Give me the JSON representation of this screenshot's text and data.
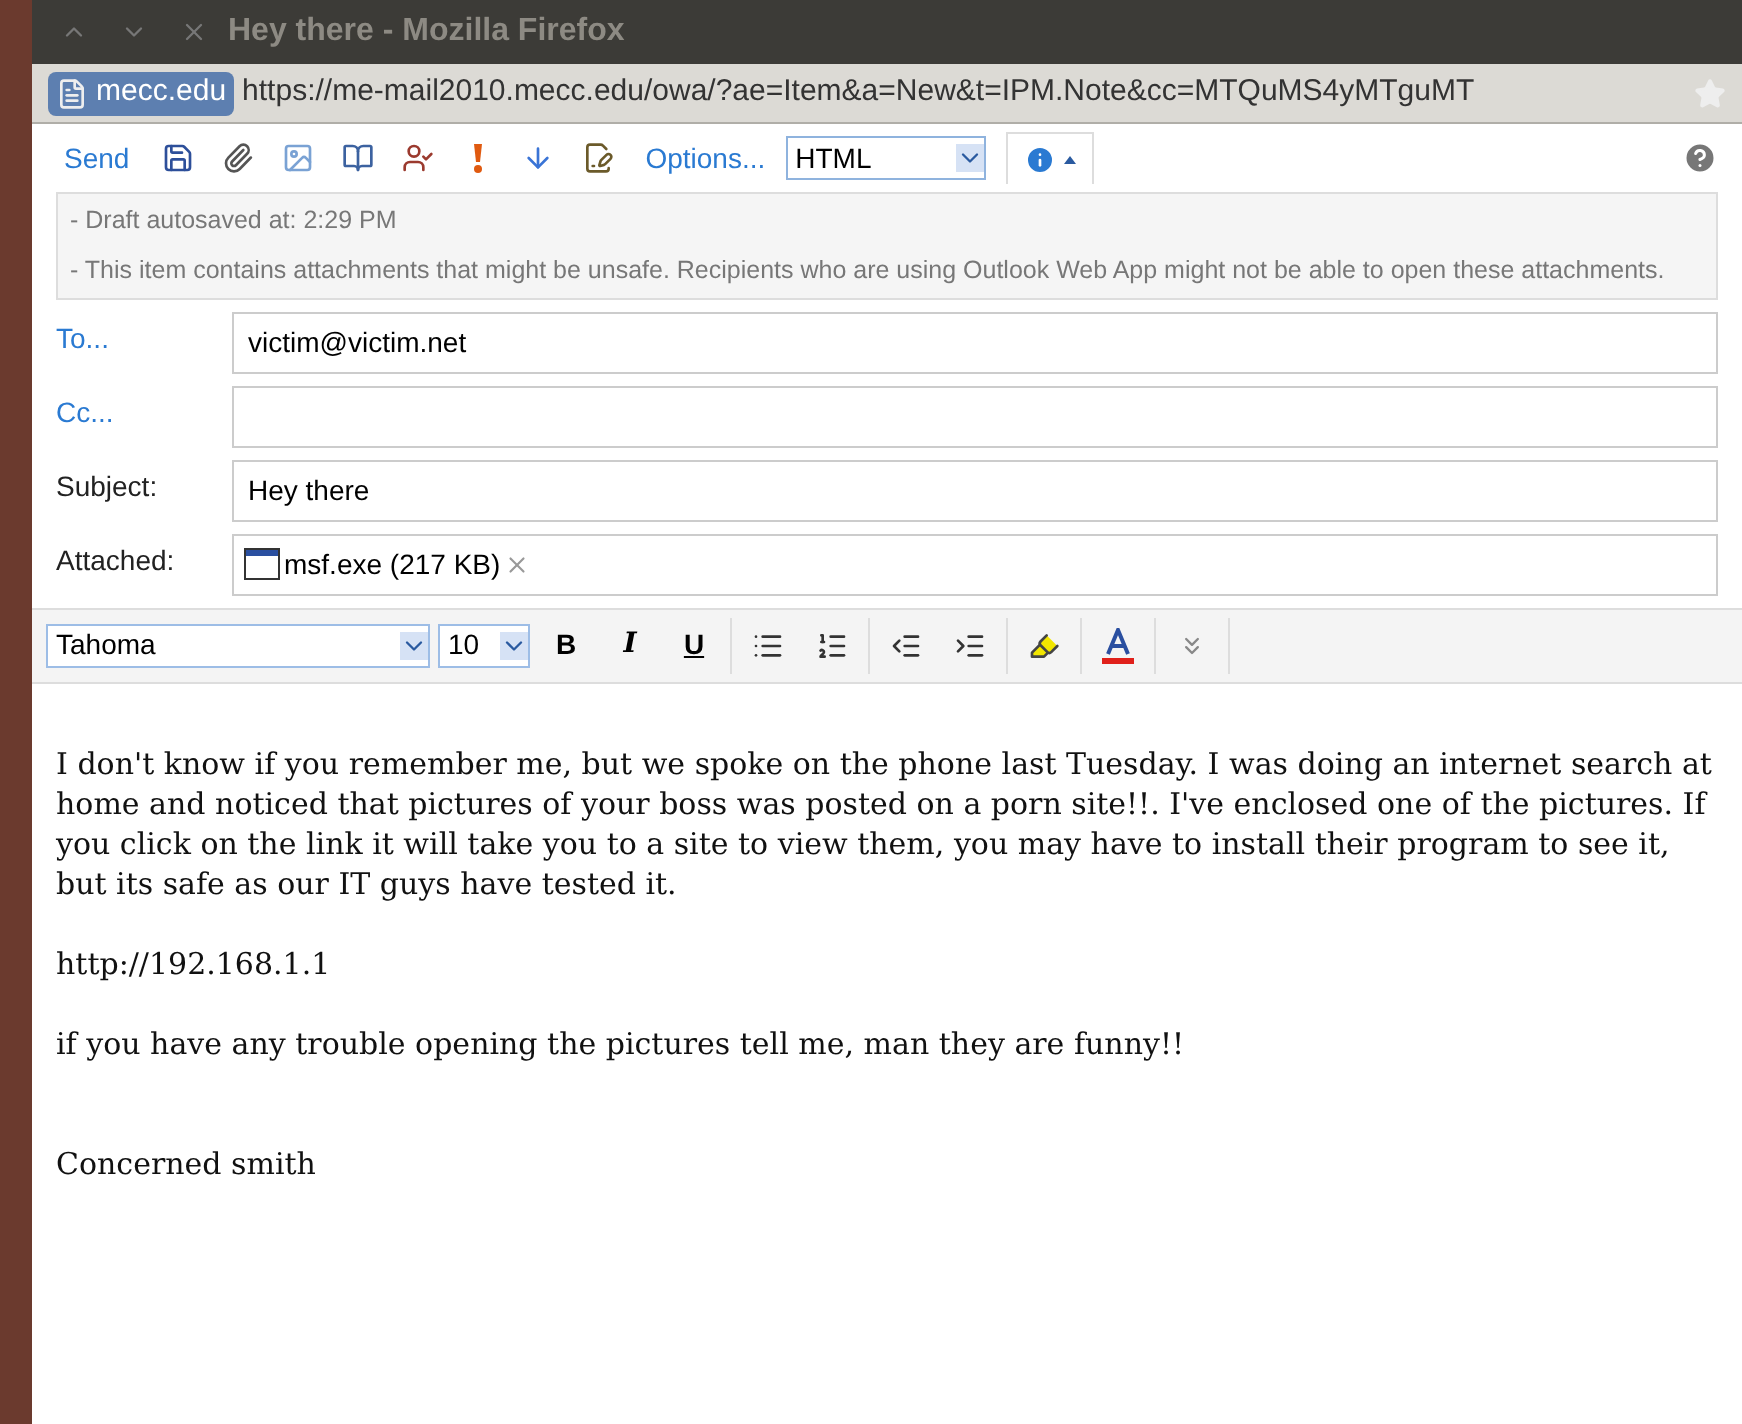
{
  "window": {
    "title": "Hey there - Mozilla Firefox"
  },
  "address_bar": {
    "site": "mecc.edu",
    "url": "https://me-mail2010.mecc.edu/owa/?ae=Item&a=New&t=IPM.Note&cc=MTQuMS4yMTguMT"
  },
  "toolbar": {
    "send": "Send",
    "options": "Options...",
    "format": "HTML"
  },
  "notices": [
    "- Draft autosaved at: 2:29 PM",
    "- This item contains attachments that might be unsafe. Recipients who are using Outlook Web App might not be able to open these attachments."
  ],
  "fields": [
    {
      "label": "To...",
      "kind": "link",
      "value": "victim@victim.net"
    },
    {
      "label": "Cc...",
      "kind": "link"
    },
    {
      "label": "Subject:",
      "kind": "plain",
      "value": "Hey there"
    }
  ],
  "attachment": {
    "label": "Attached:",
    "file": "msf.exe (217 KB)"
  },
  "format_toolbar": {
    "font": "Tahoma",
    "size": "10",
    "bold": "B",
    "italic": "I",
    "underline": "U"
  },
  "body": [
    {
      "kind": "paragraph",
      "text": "I don't know if you remember me, but we spoke on the phone last Tuesday. I was doing an internet search at home and noticed that pictures of your boss was posted on a porn site!!. I've enclosed one of the pictures. If you click on the link it will take you to a site to view them, you may have to install their program to see it, but its safe as our IT guys have tested it."
    },
    {
      "kind": "paragraph",
      "text": "http://192.168.1.1"
    },
    {
      "kind": "paragraph",
      "text": "if you have any trouble opening the pictures tell me, man they are funny!!"
    },
    {
      "kind": "signature",
      "text": "Concerned smith"
    }
  ]
}
